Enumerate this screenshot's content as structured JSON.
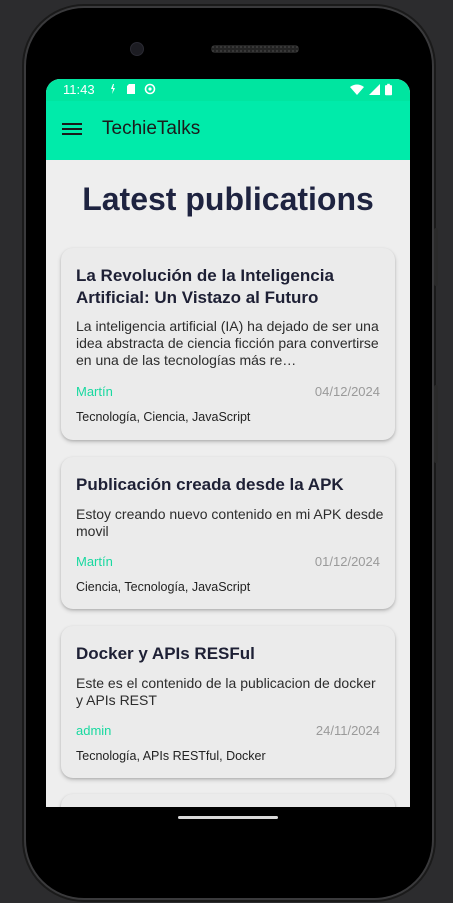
{
  "status_bar": {
    "time": "11:43",
    "left_icons": [
      "data-saver-icon",
      "sd-card-icon",
      "sync-icon"
    ],
    "right_icons": [
      "wifi-icon",
      "signal-icon",
      "battery-icon"
    ]
  },
  "app_bar": {
    "title": "TechieTalks",
    "menu_icon": "hamburger-menu-icon"
  },
  "page": {
    "title": "Latest publications"
  },
  "publications": [
    {
      "title": "La Revolución de la Inteligencia Artificial: Un Vistazo al Futuro",
      "excerpt": "La inteligencia artificial (IA) ha dejado de ser una idea abstracta de ciencia ficción para convertirse en una de las tecnologías más re…",
      "author": "Martín",
      "date": "04/12/2024",
      "tags": "Tecnología, Ciencia, JavaScript"
    },
    {
      "title": "Publicación creada desde la APK",
      "excerpt": "Estoy creando nuevo contenido en mi APK desde movil",
      "author": "Martín",
      "date": "01/12/2024",
      "tags": "Ciencia, Tecnología, JavaScript"
    },
    {
      "title": "Docker y APIs RESFul",
      "excerpt": "Este es el contenido de la publicacion de docker y APIs REST",
      "author": "admin",
      "date": "24/11/2024",
      "tags": "Tecnología, APIs RESTful, Docker"
    }
  ],
  "colors": {
    "status_bar": "#00e5a0",
    "app_bar": "#00ebaa",
    "accent_author": "#19d9a0",
    "background": "#eeeeee",
    "card": "#ebebeb",
    "title_text": "#1e2340"
  }
}
